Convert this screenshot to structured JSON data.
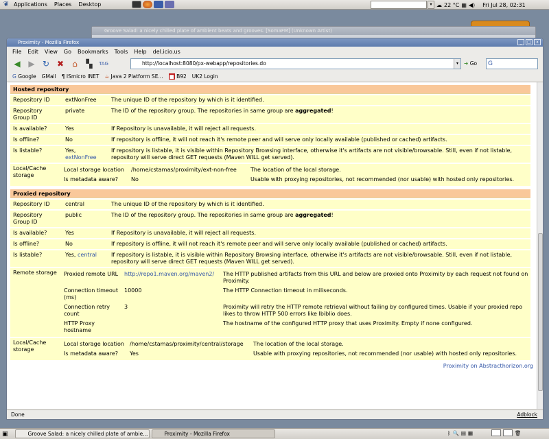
{
  "top_panel": {
    "menus": [
      "Applications",
      "Places",
      "Desktop"
    ],
    "weather": "22 °C",
    "clock": "Fri Jul 28, 02:31"
  },
  "background_window": {
    "title": "Groove Salad: a nicely chilled plate of ambient beats and grooves. [SomaFM] (Unknown Artist)"
  },
  "firefox": {
    "title": "Proximity - Mozilla Firefox",
    "menu": [
      "File",
      "Edit",
      "View",
      "Go",
      "Bookmarks",
      "Tools",
      "Help",
      "del.icio.us"
    ],
    "url": "http://localhost:8080/px-webapp/repositories.do",
    "go_label": "Go",
    "bookmarks": [
      "Google",
      "GMail",
      "ISmicro INET",
      "Java 2 Platform SE...",
      "B92",
      "UK2 Login"
    ],
    "status": "Done",
    "adblock": "Adblock",
    "footer_link": "Proximity on Abstracthorizon.org"
  },
  "hosted": {
    "header": "Hosted repository",
    "rows": [
      {
        "label": "Repository ID",
        "value": "extNonFree",
        "desc": "The unique ID of the repository by which is it identified."
      },
      {
        "label": "Repository Group ID",
        "value": "private",
        "desc_pre": "The ID of the repository group. The repositories in same group are ",
        "desc_bold": "aggregated",
        "desc_post": "!"
      },
      {
        "label": "Is available?",
        "value": "Yes",
        "desc": "If Repository is unavailable, it will reject all requests."
      },
      {
        "label": "Is offline?",
        "value": "No",
        "desc": "If repository is offline, it will not reach it's remote peer and will serve only locally available (published or cached) artifacts."
      },
      {
        "label": "Is listable?",
        "value": "Yes,",
        "value_link": "extNonFree",
        "desc": "If repository is listable, it is visible within Repository Browsing interface, otherwise it's artifacts are not visible/browsable. Still, even if not listable, repository will serve direct GET requests (Maven WILL get served)."
      }
    ],
    "storage_label": "Local/Cache storage",
    "storage": [
      {
        "label": "Local storage location",
        "value": "/home/cstamas/proximity/ext-non-free",
        "desc": "The location of the local storage."
      },
      {
        "label": "Is metadata aware?",
        "value": "No",
        "desc": "Usable with proxying repositories, not recommended (nor usable) with hosted only repositories."
      }
    ]
  },
  "proxied": {
    "header": "Proxied repository",
    "rows": [
      {
        "label": "Repository ID",
        "value": "central",
        "desc": "The unique ID of the repository by which is it identified."
      },
      {
        "label": "Repository Group ID",
        "value": "public",
        "desc_pre": "The ID of the repository group. The repositories in same group are ",
        "desc_bold": "aggregated",
        "desc_post": "!"
      },
      {
        "label": "Is available?",
        "value": "Yes",
        "desc": "If Repository is unavailable, it will reject all requests."
      },
      {
        "label": "Is offline?",
        "value": "No",
        "desc": "If repository is offline, it will not reach it's remote peer and will serve only locally available (published or cached) artifacts."
      },
      {
        "label": "Is listable?",
        "value": "Yes,",
        "value_link": "central",
        "desc": "If repository is listable, it is visible within Repository Browsing interface, otherwise it's artifacts are not visible/browsable. Still, even if not listable, repository will serve direct GET requests (Maven WILL get served)."
      }
    ],
    "remote_label": "Remote storage",
    "remote": [
      {
        "label": "Proxied remote URL",
        "value": "http://repo1.maven.org/maven2/",
        "desc": "The HTTP published artifacts from this URL and below are proxied onto Proximity by each request not found on Proximity."
      },
      {
        "label": "Connection timeout (ms)",
        "value": "10000",
        "desc": "The HTTP Connection timeout in miliseconds."
      },
      {
        "label": "Connection retry count",
        "value": "3",
        "desc": "Proximity will retry the HTTP remote retrieval without failing by configured times. Usable if your proxied repo likes to throw HTTP 500 errors like Ibiblio does."
      },
      {
        "label": "HTTP Proxy hostname",
        "value": "",
        "desc": "The hostname of the configured HTTP proxy that uses Proximity. Empty if none configured."
      }
    ],
    "storage_label": "Local/Cache storage",
    "storage": [
      {
        "label": "Local storage location",
        "value": "/home/cstamas/proximity/central/storage",
        "desc": "The location of the local storage."
      },
      {
        "label": "Is metadata aware?",
        "value": "Yes",
        "desc": "Usable with proxying repositories, not recommended (nor usable) with hosted only repositories."
      }
    ]
  },
  "taskbar": {
    "tasks": [
      "Groove Salad: a nicely chilled plate of ambie...",
      "Proximity - Mozilla Firefox"
    ]
  }
}
